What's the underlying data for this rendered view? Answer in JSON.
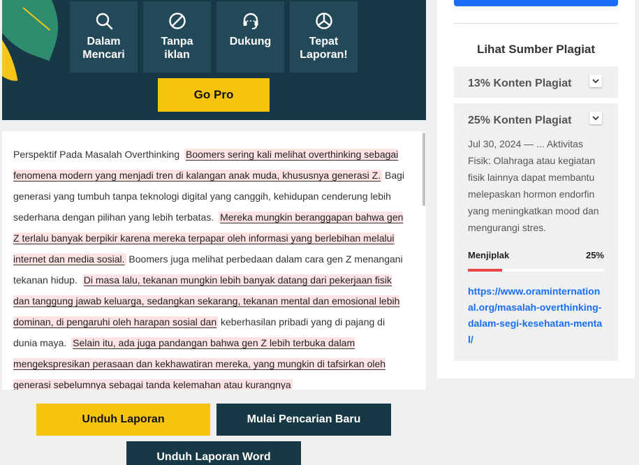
{
  "promo": {
    "features": [
      {
        "icon": "search-icon",
        "label_line1": "Dalam",
        "label_line2": "Mencari"
      },
      {
        "icon": "no-ads-icon",
        "label_line1": "Tanpa",
        "label_line2": "iklan"
      },
      {
        "icon": "headset-icon",
        "label_line1": "Dukung",
        "label_line2": ""
      },
      {
        "icon": "pie-chart-icon",
        "label_line1": "Tepat",
        "label_line2": "Laporan!"
      }
    ],
    "go_pro_label": "Go Pro",
    "accent_color": "#f6c30e",
    "background_color": "#173845"
  },
  "report_text": {
    "segments": [
      {
        "text": "Perspektif Pada Masalah Overthinking ",
        "plagiarized": false
      },
      {
        "text": "Boomers sering kali melihat overthinking sebagai fenomena modern yang menjadi tren di kalangan anak muda, khususnya generasi Z.",
        "plagiarized": true
      },
      {
        "text": " Bagi generasi yang tumbuh tanpa teknologi digital yang canggih, kehidupan cenderung lebih sederhana dengan pilihan yang lebih terbatas. ",
        "plagiarized": false
      },
      {
        "text": "Mereka mungkin beranggapan bahwa gen Z terlalu banyak berpikir karena mereka terpapar oleh informasi yang berlebihan melalui internet dan media sosial.",
        "plagiarized": true
      },
      {
        "text": " Boomers juga melihat perbedaan dalam cara gen Z menangani tekanan hidup. ",
        "plagiarized": false
      },
      {
        "text": "Di masa lalu, tekanan mungkin lebih banyak datang dari pekerjaan fisik dan tanggung jawab keluarga, sedangkan sekarang, tekanan mental dan emosional lebih dominan, di pengaruhi oleh harapan sosial dan",
        "plagiarized": true
      },
      {
        "text": " keberhasilan pribadi yang di pajang di dunia maya. ",
        "plagiarized": false
      },
      {
        "text": "Selain itu, ada juga pandangan bahwa gen Z lebih terbuka dalam mengekspresikan perasaan dan kekhawatiran mereka, yang mungkin di tafsirkan oleh generasi sebelumnya sebagai tanda kelemahan atau kurangnya",
        "plagiarized": true
      }
    ]
  },
  "buttons": {
    "download_report": "Unduh Laporan",
    "new_search": "Mulai Pencarian Baru",
    "download_word": "Unduh Laporan Word"
  },
  "sidebar": {
    "title": "Lihat Sumber Plagiat",
    "cards": [
      {
        "title": "13% Konten Plagiat"
      },
      {
        "title": "25% Konten Plagiat",
        "snippet": "Jul 30, 2024 — ... Aktivitas Fisik: Olahraga atau kegiatan fisik lainnya dapat membantu melepaskan hormon endorfin yang meningkatkan mood dan mengurangi stres.",
        "meta_label": "Menjiplak",
        "meta_value": "25%",
        "percent": 25,
        "url": "https://www.oraminternational.org/masalah-overthinking-dalam-segi-kesehatan-mental/"
      }
    ]
  }
}
